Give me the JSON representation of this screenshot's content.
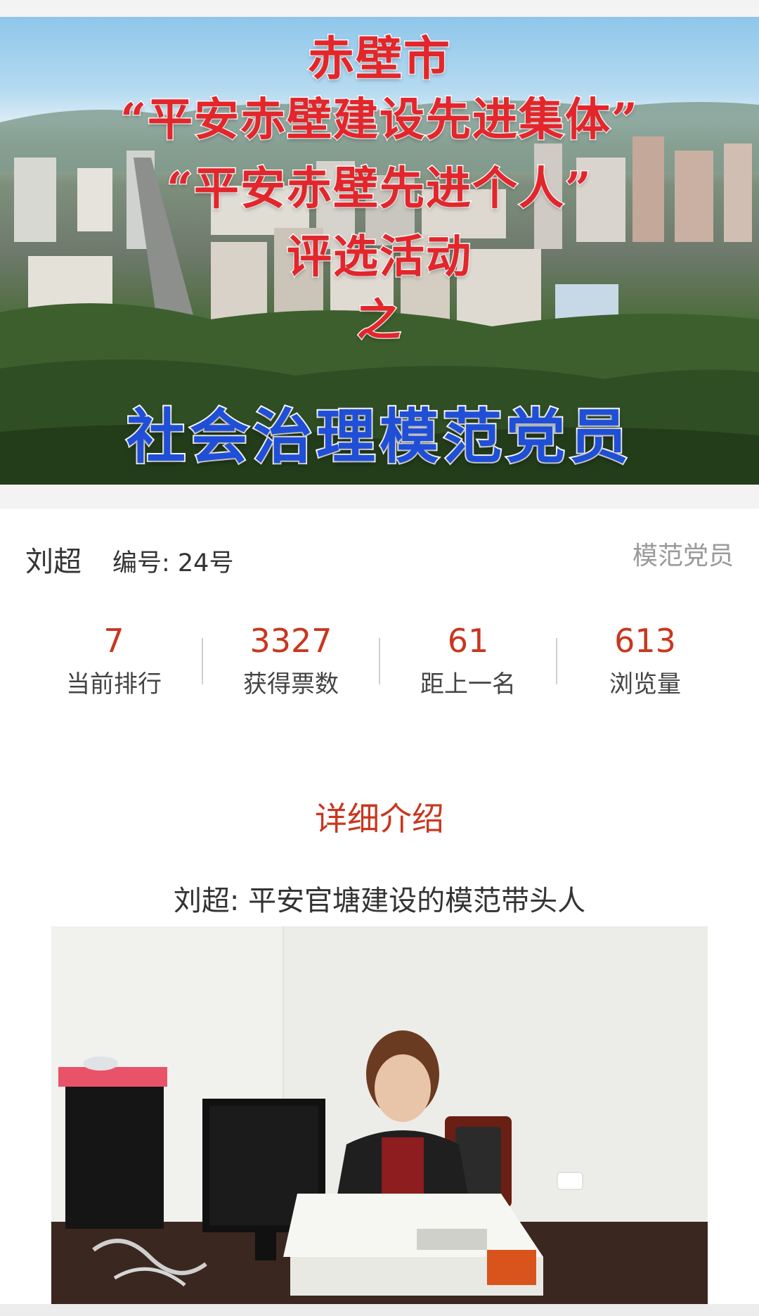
{
  "banner": {
    "line1": "赤壁市",
    "line2": "“平安赤壁建设先进集体”",
    "line3": "“平安赤壁先进个人”",
    "line4": "评选活动",
    "line5": "之",
    "subtitle": "社会治理模范党员"
  },
  "candidate": {
    "name": "刘超",
    "number": "编号: 24号",
    "category": "模范党员"
  },
  "stats": [
    {
      "value": "7",
      "label": "当前排行"
    },
    {
      "value": "3327",
      "label": "获得票数"
    },
    {
      "value": "61",
      "label": "距上一名"
    },
    {
      "value": "613",
      "label": "浏览量"
    }
  ],
  "detail": {
    "section_title": "详细介绍",
    "article_title": "刘超: 平安官塘建设的模范带头人"
  },
  "colors": {
    "accent": "#c8371f",
    "banner_red": "#e3262b",
    "banner_blue": "#1f4fd6",
    "muted": "#9a9a9a"
  }
}
